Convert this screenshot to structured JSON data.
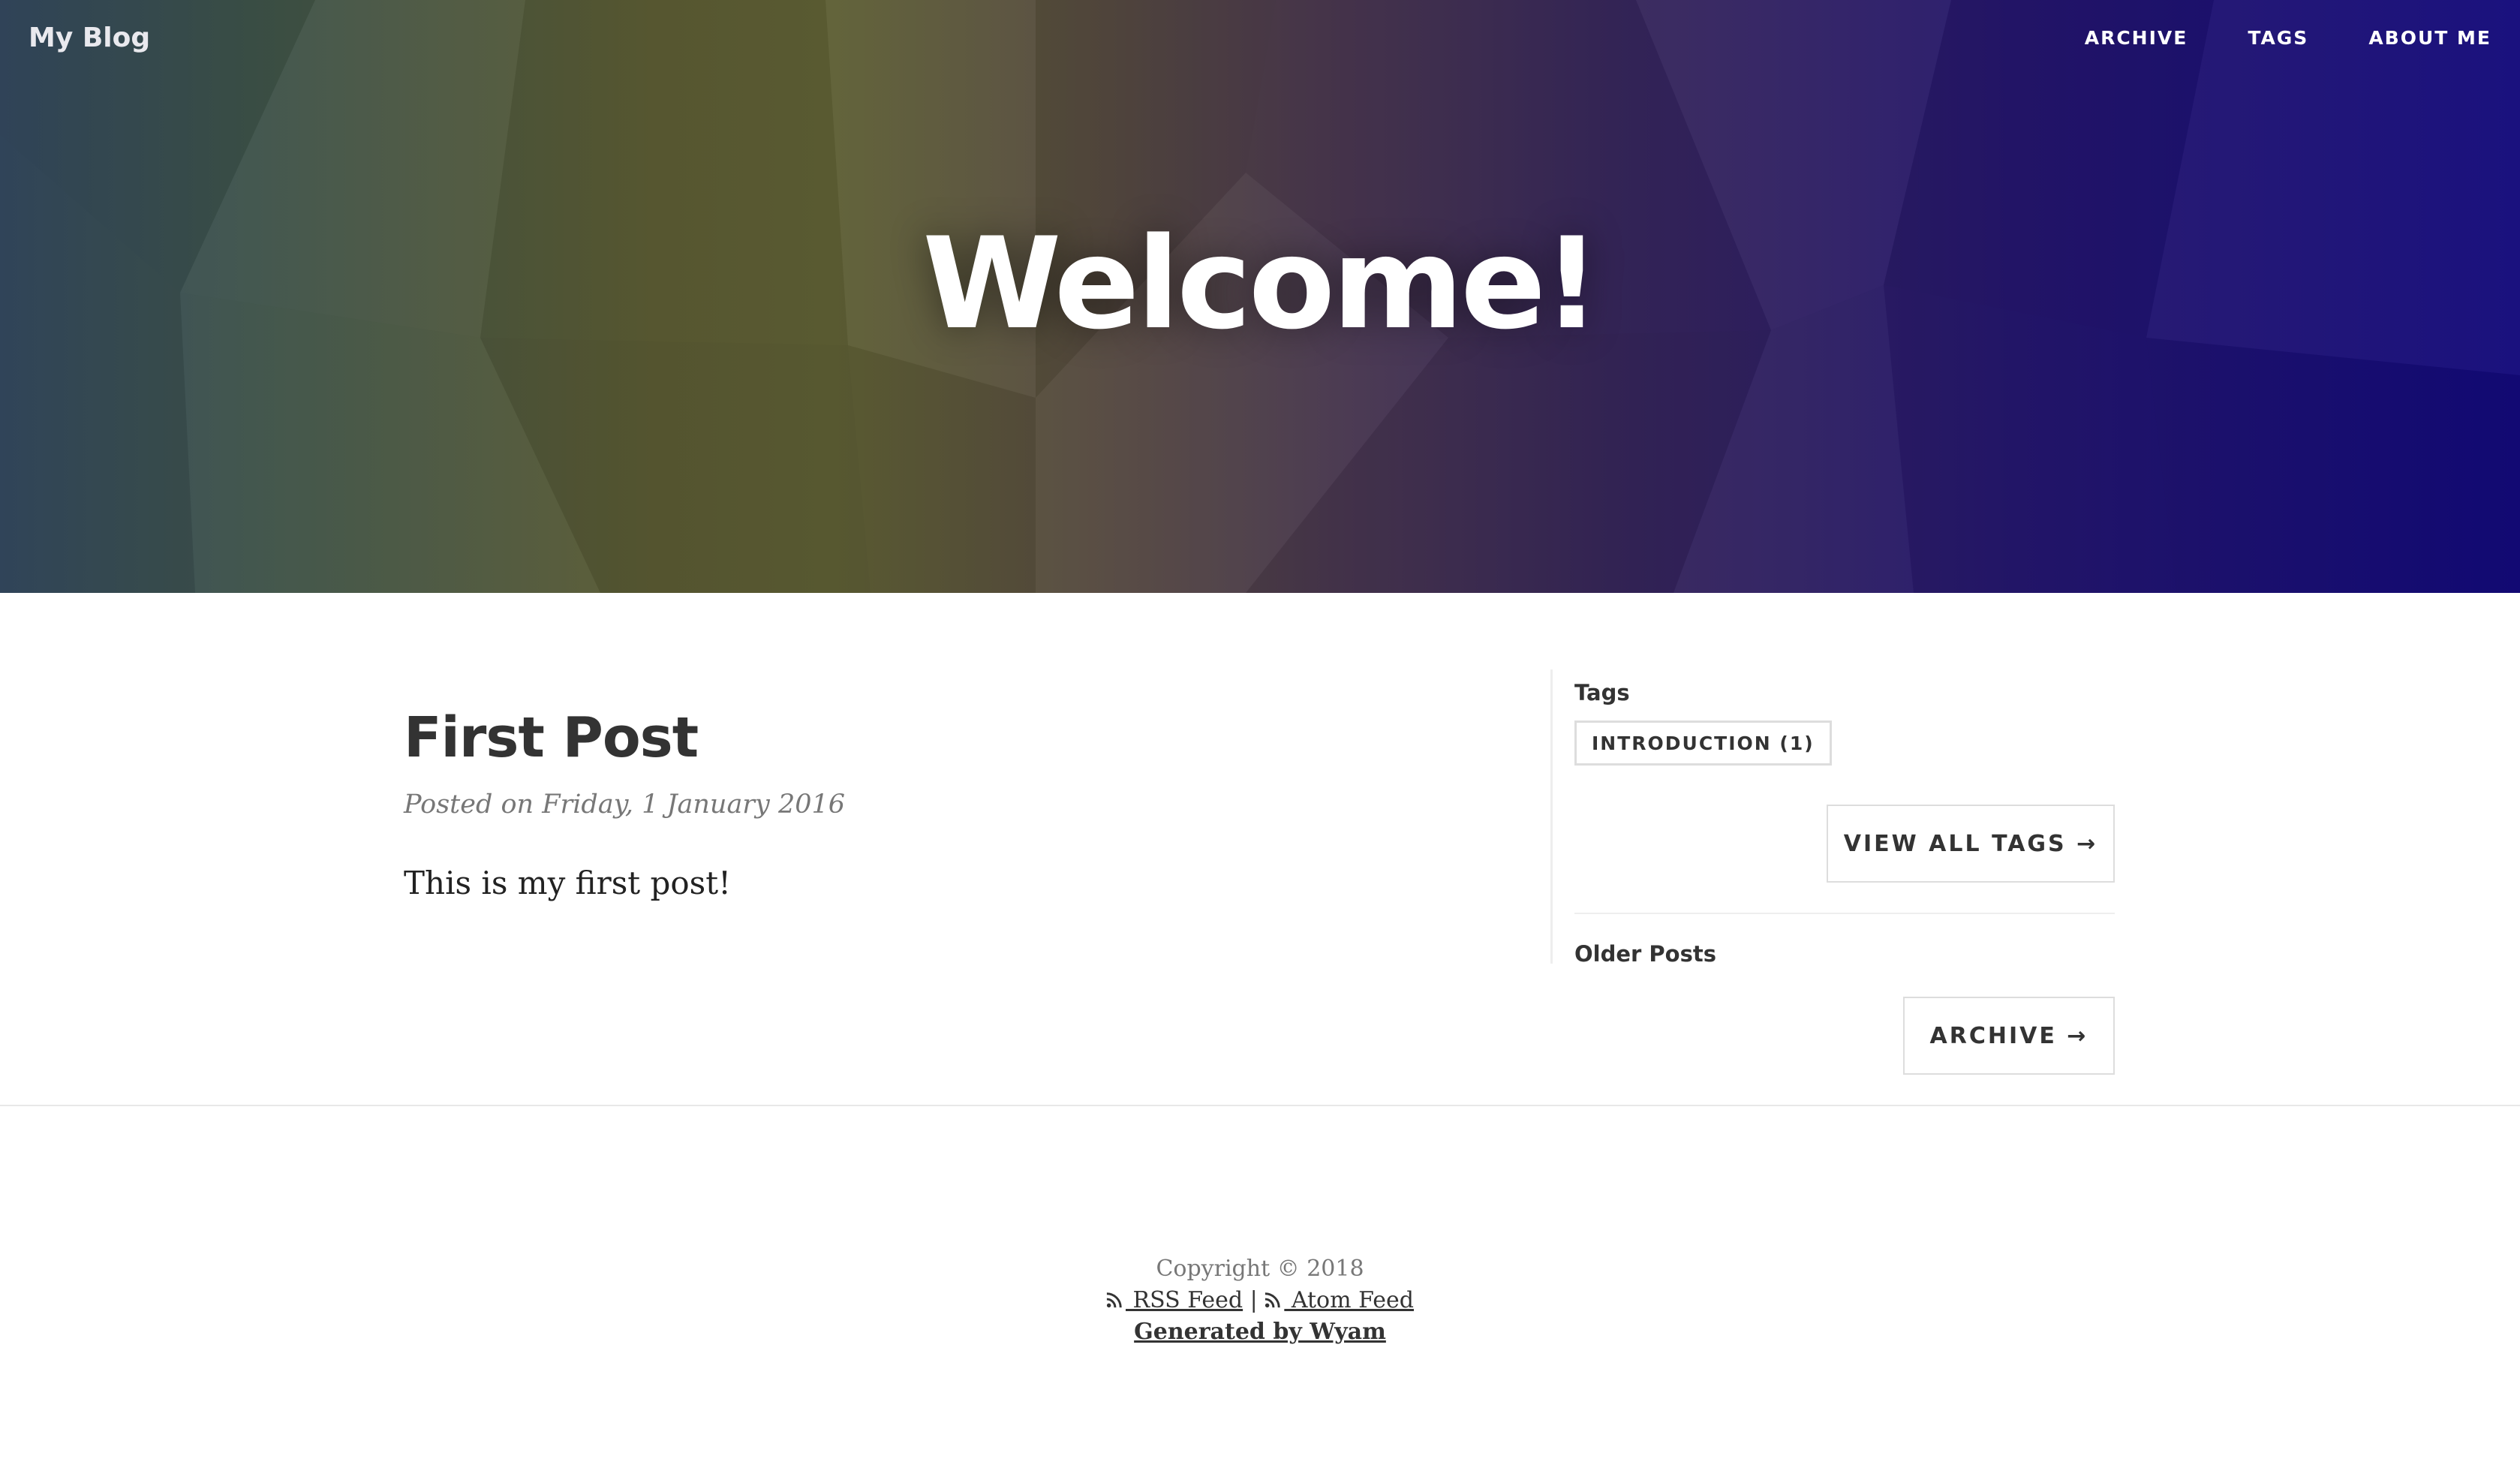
{
  "nav": {
    "brand": "My Blog",
    "links": [
      "ARCHIVE",
      "TAGS",
      "ABOUT ME"
    ]
  },
  "hero": {
    "title": "Welcome!"
  },
  "post": {
    "title": "First Post",
    "meta": "Posted on Friday, 1 January 2016",
    "content": "This is my first post!"
  },
  "sidebar": {
    "tags_heading": "Tags",
    "tags": [
      {
        "label": "INTRODUCTION (1)"
      }
    ],
    "view_all_tags_label": "VIEW ALL TAGS →",
    "older_posts_heading": "Older Posts",
    "archive_label": "ARCHIVE →"
  },
  "footer": {
    "copyright": "Copyright © 2018",
    "rss_label": " RSS Feed",
    "separator": "|",
    "atom_label": " Atom Feed",
    "generated_label": "Generated by Wyam"
  },
  "colors": {
    "text": "#333333",
    "muted": "#777777",
    "border": "#dddddd",
    "hero_left": "#33485e",
    "hero_mid": "#5d5e34",
    "hero_right": "#130a7a"
  },
  "icons": {
    "feed_icon": "rss-icon"
  }
}
